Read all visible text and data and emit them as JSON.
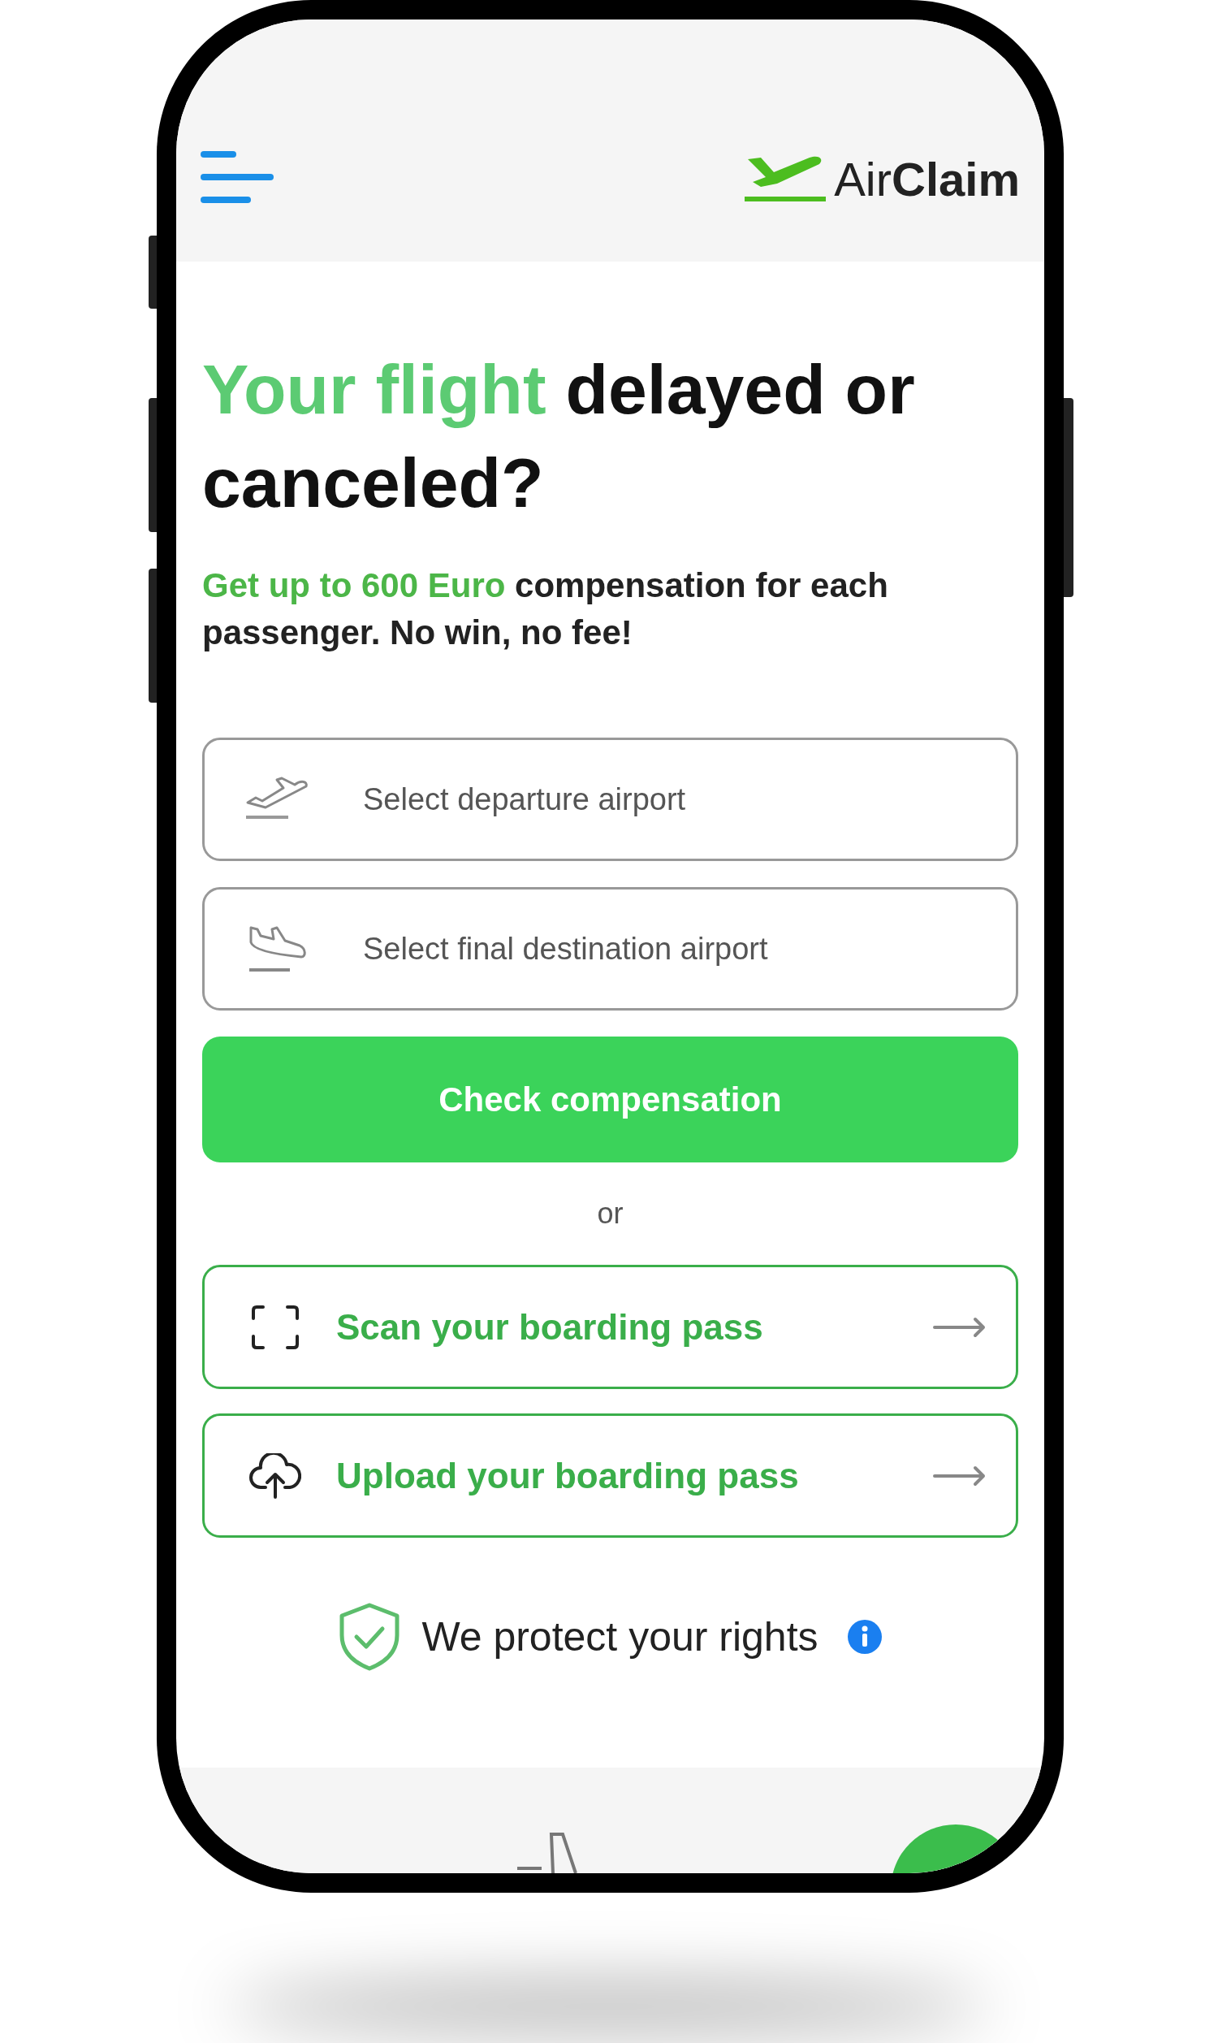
{
  "header": {
    "menu": true,
    "logo": {
      "light": "Air",
      "bold": "Claim"
    }
  },
  "hero": {
    "heading": [
      {
        "text": "Your flight",
        "highlight": true
      },
      {
        "text": " delayed or canceled?",
        "highlight": false
      }
    ],
    "subtitle": [
      {
        "text": "Get up to 600 Euro",
        "highlight": true
      },
      {
        "text": " compensation for each passenger. No win, no fee!",
        "highlight": false
      }
    ]
  },
  "fields": [
    {
      "kind": "departure",
      "placeholder": "Select departure airport"
    },
    {
      "kind": "arrival",
      "placeholder": "Select final destination airport"
    }
  ],
  "primary_button": "Check compensation",
  "separator": "or",
  "options": [
    {
      "kind": "scan",
      "label": "Scan your boarding pass"
    },
    {
      "kind": "upload",
      "label": "Upload your boarding pass"
    }
  ],
  "trust": {
    "text": "We protect your rights",
    "info": true
  }
}
